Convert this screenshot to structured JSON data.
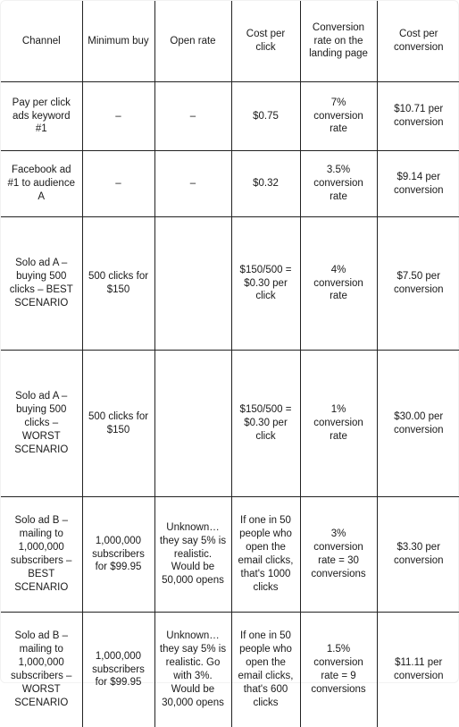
{
  "table": {
    "headers": [
      "Channel",
      "Minimum buy",
      "Open rate",
      "Cost per click",
      "Conversion rate on the landing page",
      "Cost per conversion"
    ],
    "rows": [
      {
        "channel": "Pay per click ads keyword #1",
        "minimum_buy": "–",
        "open_rate": "–",
        "cost_per_click": "$0.75",
        "conversion_rate": "7% conversion rate",
        "cost_per_conversion": "$10.71 per conversion"
      },
      {
        "channel": "Facebook ad #1 to audience A",
        "minimum_buy": "–",
        "open_rate": "–",
        "cost_per_click": "$0.32",
        "conversion_rate": "3.5% conversion rate",
        "cost_per_conversion": "$9.14 per conversion"
      },
      {
        "channel": "Solo ad A – buying 500 clicks – BEST SCENARIO",
        "minimum_buy": "500 clicks for $150",
        "open_rate": "",
        "cost_per_click": "$150/500 = $0.30 per click",
        "conversion_rate": "4% conversion rate",
        "cost_per_conversion": "$7.50 per conversion"
      },
      {
        "channel": "Solo ad A – buying 500 clicks – WORST SCENARIO",
        "minimum_buy": "500 clicks for $150",
        "open_rate": "",
        "cost_per_click": "$150/500 = $0.30 per click",
        "conversion_rate": "1% conversion rate",
        "cost_per_conversion": "$30.00 per conversion"
      },
      {
        "channel": "Solo ad B – mailing to 1,000,000 subscribers – BEST SCENARIO",
        "minimum_buy": "1,000,000 subscribers for $99.95",
        "open_rate": "Unknown… they say 5% is realistic. Would be 50,000 opens",
        "cost_per_click": "If one in 50 people who open the email clicks, that's 1000 clicks",
        "conversion_rate": "3% conversion rate = 30 conversions",
        "cost_per_conversion": "$3.30 per conversion"
      },
      {
        "channel": "Solo ad B – mailing to 1,000,000 subscribers – WORST SCENARIO",
        "minimum_buy": "1,000,000 subscribers for $99.95",
        "open_rate": "Unknown… they say 5% is realistic. Go with 3%. Would be 30,000 opens",
        "cost_per_click": "If one in 50 people who open the email clicks, that's 600 clicks",
        "conversion_rate": "1.5% conversion rate = 9 conversions",
        "cost_per_conversion": "$11.11 per conversion"
      }
    ]
  }
}
